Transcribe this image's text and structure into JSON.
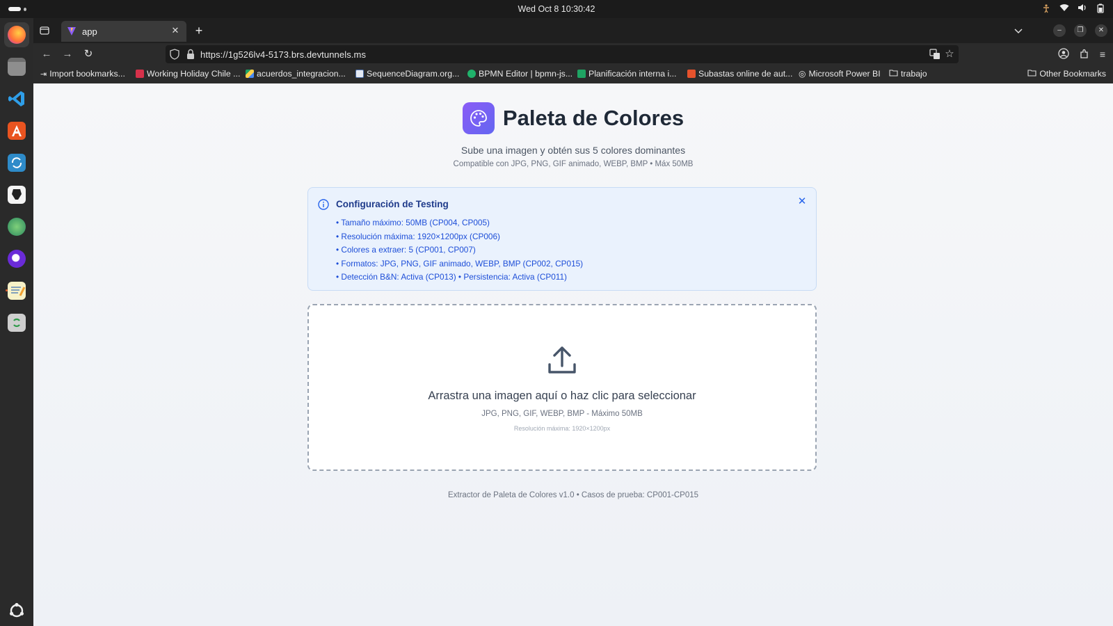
{
  "system": {
    "clock": "Wed Oct 8  10:30:42"
  },
  "browser": {
    "tab_title": "app",
    "url": "https://1g526lv4-5173.brs.devtunnels.ms",
    "bookmarks": [
      "Import bookmarks...",
      "Working Holiday Chile ...",
      "acuerdos_integracion...",
      "SequenceDiagram.org...",
      "BPMN Editor | bpmn-js...",
      "Planificación interna i...",
      "Subastas online de aut...",
      "Microsoft Power BI",
      "trabajo",
      "Other Bookmarks"
    ]
  },
  "page": {
    "title": "Paleta de Colores",
    "subtitle": "Sube una imagen y obtén sus 5 colores dominantes",
    "formats_note": "Compatible con JPG, PNG, GIF animado, WEBP, BMP • Máx 50MB",
    "info": {
      "title": "Configuración de Testing",
      "items": [
        "Tamaño máximo: 50MB (CP004, CP005)",
        "Resolución máxima: 1920×1200px (CP006)",
        "Colores a extraer: 5 (CP001, CP007)",
        "Formatos: JPG, PNG, GIF animado, WEBP, BMP (CP002, CP015)",
        "Detección B&N: Activa (CP013) • Persistencia: Activa (CP011)"
      ]
    },
    "dropzone": {
      "title": "Arrastra una imagen aquí o haz clic para seleccionar",
      "formats": "JPG, PNG, GIF, WEBP, BMP - Máximo 50MB",
      "resolution": "Resolución máxima: 1920×1200px"
    },
    "footer": "Extractor de Paleta de Colores v1.0 • Casos de prueba: CP001-CP015"
  },
  "colors": {
    "accent_purple": "#8b5cf6",
    "info_bg": "#eaf2fd",
    "info_text": "#1d4ed8"
  }
}
